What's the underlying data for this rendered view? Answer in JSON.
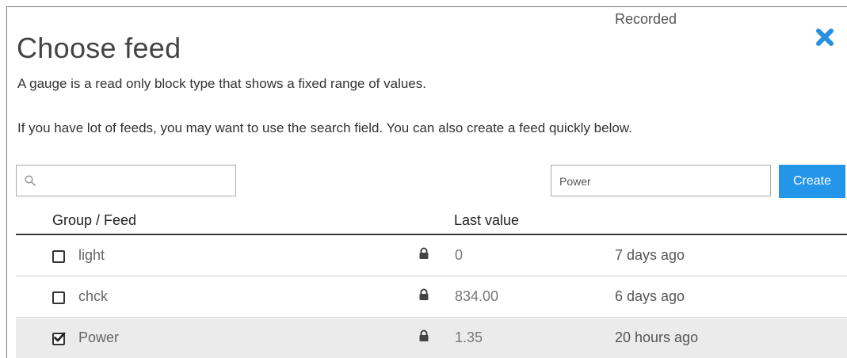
{
  "modal": {
    "title": "Choose feed",
    "description": "A gauge is a read only block type that shows a fixed range of values.",
    "hint": "If you have lot of feeds, you may want to use the search field. You can also create a feed quickly below."
  },
  "search": {
    "placeholder": "",
    "value": ""
  },
  "create": {
    "input_value": "Power",
    "button_label": "Create"
  },
  "table": {
    "headers": {
      "group_feed": "Group / Feed",
      "last_value": "Last value",
      "recorded": "Recorded"
    },
    "rows": [
      {
        "name": "light",
        "last_value": "0",
        "recorded": "7 days ago",
        "checked": false
      },
      {
        "name": "chck",
        "last_value": "834.00",
        "recorded": "6 days ago",
        "checked": false
      },
      {
        "name": "Power",
        "last_value": "1.35",
        "recorded": "20 hours ago",
        "checked": true
      }
    ]
  },
  "colors": {
    "accent": "#2396e9",
    "selected_row": "#ebebeb"
  }
}
